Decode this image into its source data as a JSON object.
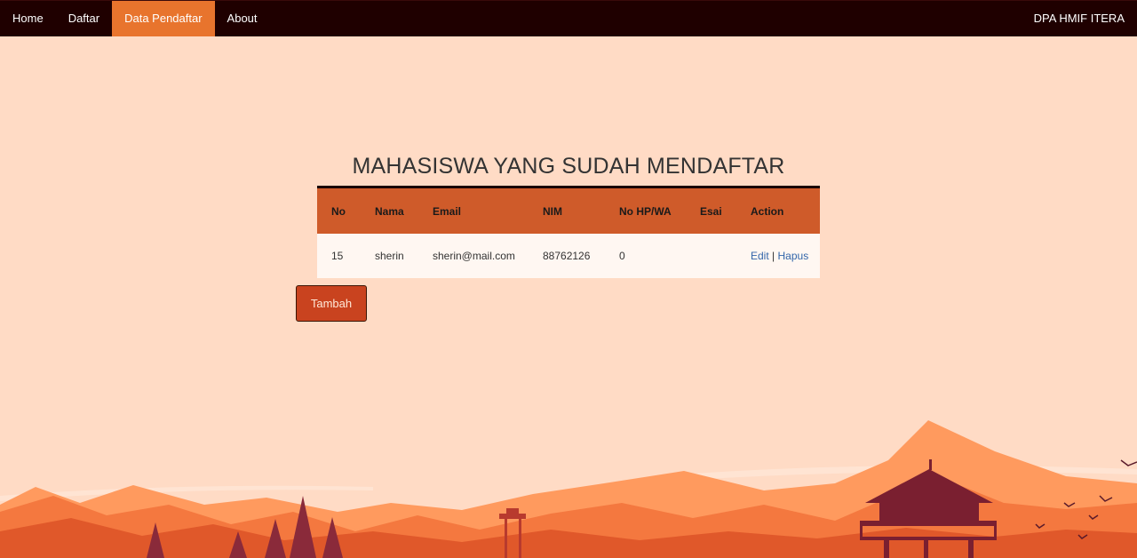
{
  "nav": {
    "links": [
      {
        "label": "Home"
      },
      {
        "label": "Daftar"
      },
      {
        "label": "Data Pendaftar"
      },
      {
        "label": "About"
      }
    ],
    "active_index": 2,
    "brand": "DPA HMIF ITERA"
  },
  "main": {
    "title": "MAHASISWA YANG SUDAH MENDAFTAR",
    "table": {
      "headers": [
        "No",
        "Nama",
        "Email",
        "NIM",
        "No HP/WA",
        "Esai",
        "Action"
      ],
      "rows": [
        {
          "no": "15",
          "nama": "sherin",
          "email": "sherin@mail.com",
          "nim": "88762126",
          "hp": "0",
          "esai": "",
          "edit": "Edit",
          "sep": "|",
          "hapus": "Hapus"
        }
      ]
    },
    "add_button": "Tambah"
  },
  "colors": {
    "navbar": "#1f0000",
    "active_tab": "#e8742d",
    "table_header": "#cf5b2a",
    "button": "#c9431f",
    "background": "#ffdbc5"
  }
}
